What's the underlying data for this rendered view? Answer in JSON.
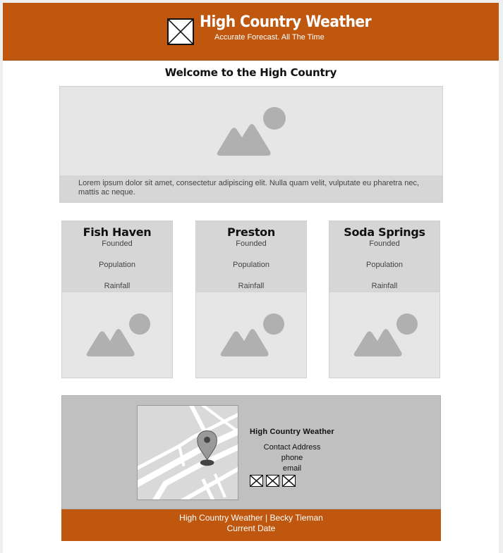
{
  "header": {
    "title": "High Country Weather",
    "tagline": "Accurate Forecast. All The Time",
    "logo_icon": "image-placeholder-icon",
    "background": "#c0570f"
  },
  "welcome": {
    "heading": "Welcome to the High Country",
    "hero_icon": "image-placeholder-icon",
    "caption": "Lorem ipsum dolor sit amet, consectetur adipiscing elit. Nulla quam velit, vulputate eu pharetra nec, mattis ac neque."
  },
  "cities": [
    {
      "name": "Fish Haven",
      "founded": "Founded",
      "population": "Population",
      "rainfall": "Rainfall"
    },
    {
      "name": "Preston",
      "founded": "Founded",
      "population": "Population",
      "rainfall": "Rainfall"
    },
    {
      "name": "Soda Springs",
      "founded": "Founded",
      "population": "Population",
      "rainfall": "Rainfall"
    }
  ],
  "contact": {
    "map_icon": "map-pin-icon",
    "title": "High Country Weather",
    "address": "Contact Address",
    "phone": "phone",
    "email": "email",
    "social_icons": [
      "social-icon",
      "social-icon",
      "social-icon"
    ]
  },
  "footer": {
    "line1": "High Country Weather | Becky Tieman",
    "line2": "Current Date"
  },
  "colors": {
    "accent": "#c0570f",
    "panel": "#c0c0c0",
    "placeholder": "#e6e6e6"
  }
}
